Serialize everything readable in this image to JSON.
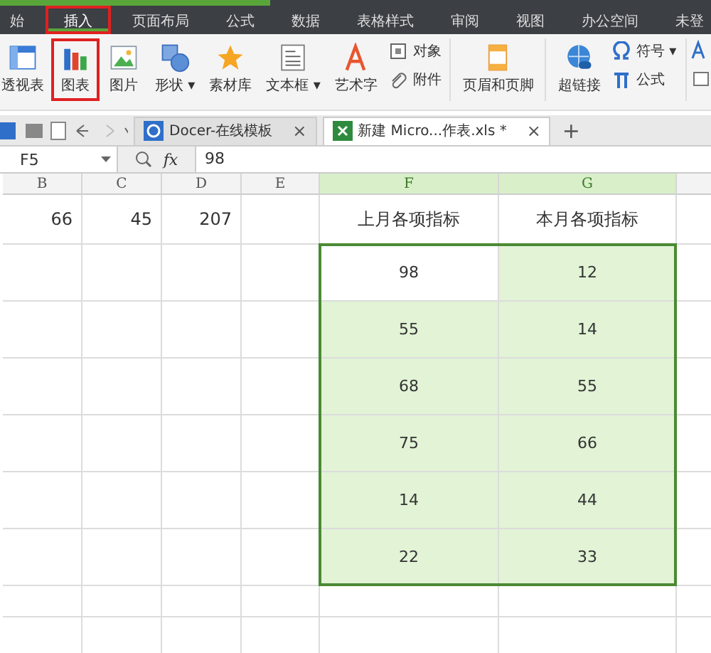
{
  "menu_bar": {
    "tabs": [
      {
        "label": "始",
        "selected": false
      },
      {
        "label": "插入",
        "selected": true
      },
      {
        "label": "页面布局",
        "selected": false
      },
      {
        "label": "公式",
        "selected": false
      },
      {
        "label": "数据",
        "selected": false
      },
      {
        "label": "表格样式",
        "selected": false
      },
      {
        "label": "审阅",
        "selected": false
      },
      {
        "label": "视图",
        "selected": false
      },
      {
        "label": "办公空间",
        "selected": false
      },
      {
        "label": "未登",
        "selected": false
      }
    ]
  },
  "ribbon": {
    "large": [
      {
        "kind": "pivot",
        "label": "透视表",
        "highlighted": false
      },
      {
        "kind": "chart",
        "label": "图表",
        "highlighted": true
      },
      {
        "kind": "picture",
        "label": "图片",
        "highlighted": false
      },
      {
        "kind": "shape",
        "label": "形状 ▾",
        "highlighted": false
      },
      {
        "kind": "star",
        "label": "素材库",
        "highlighted": false
      },
      {
        "kind": "textbox",
        "label": "文本框 ▾",
        "highlighted": false
      },
      {
        "kind": "art",
        "label": "艺术字",
        "highlighted": false
      }
    ],
    "small_1": [
      {
        "kind": "object",
        "label": "对象"
      },
      {
        "kind": "attach",
        "label": "附件"
      }
    ],
    "header_footer": {
      "label": "页眉和页脚"
    },
    "hyperlink": {
      "label": "超链接"
    },
    "small_2": [
      {
        "kind": "omega",
        "label": "符号 ▾"
      },
      {
        "kind": "pi",
        "label": "公式"
      }
    ]
  },
  "tab_bar": {
    "tabs": [
      {
        "label": "Docer-在线模板",
        "selected": false,
        "close": "×"
      },
      {
        "label": "新建 Micro...作表.xls *",
        "selected": true,
        "close": "×"
      }
    ],
    "add": "+"
  },
  "formula_bar": {
    "cell_ref": "F5",
    "fx": "fx",
    "value": "98"
  },
  "grid": {
    "columns": [
      {
        "label": "B",
        "selected": false
      },
      {
        "label": "C",
        "selected": false
      },
      {
        "label": "D",
        "selected": false
      },
      {
        "label": "E",
        "selected": false
      },
      {
        "label": "F",
        "selected": true
      },
      {
        "label": "G",
        "selected": true
      }
    ],
    "first_row": {
      "values": [
        "66",
        "45",
        "207"
      ],
      "titles": [
        "上月各项指标",
        "本月各项指标"
      ]
    },
    "selection_rows": [
      {
        "cells": [
          {
            "text": "98",
            "selected": true,
            "active": true
          },
          {
            "text": "12",
            "selected": true,
            "active": false
          }
        ]
      },
      {
        "cells": [
          {
            "text": "55",
            "selected": true,
            "active": false
          },
          {
            "text": "14",
            "selected": true,
            "active": false
          }
        ]
      },
      {
        "cells": [
          {
            "text": "68",
            "selected": true,
            "active": false
          },
          {
            "text": "55",
            "selected": true,
            "active": false
          }
        ]
      },
      {
        "cells": [
          {
            "text": "75",
            "selected": true,
            "active": false
          },
          {
            "text": "66",
            "selected": true,
            "active": false
          }
        ]
      },
      {
        "cells": [
          {
            "text": "14",
            "selected": true,
            "active": false
          },
          {
            "text": "44",
            "selected": true,
            "active": false
          }
        ]
      },
      {
        "cells": [
          {
            "text": "22",
            "selected": true,
            "active": false
          },
          {
            "text": "33",
            "selected": true,
            "active": false
          }
        ]
      }
    ]
  }
}
